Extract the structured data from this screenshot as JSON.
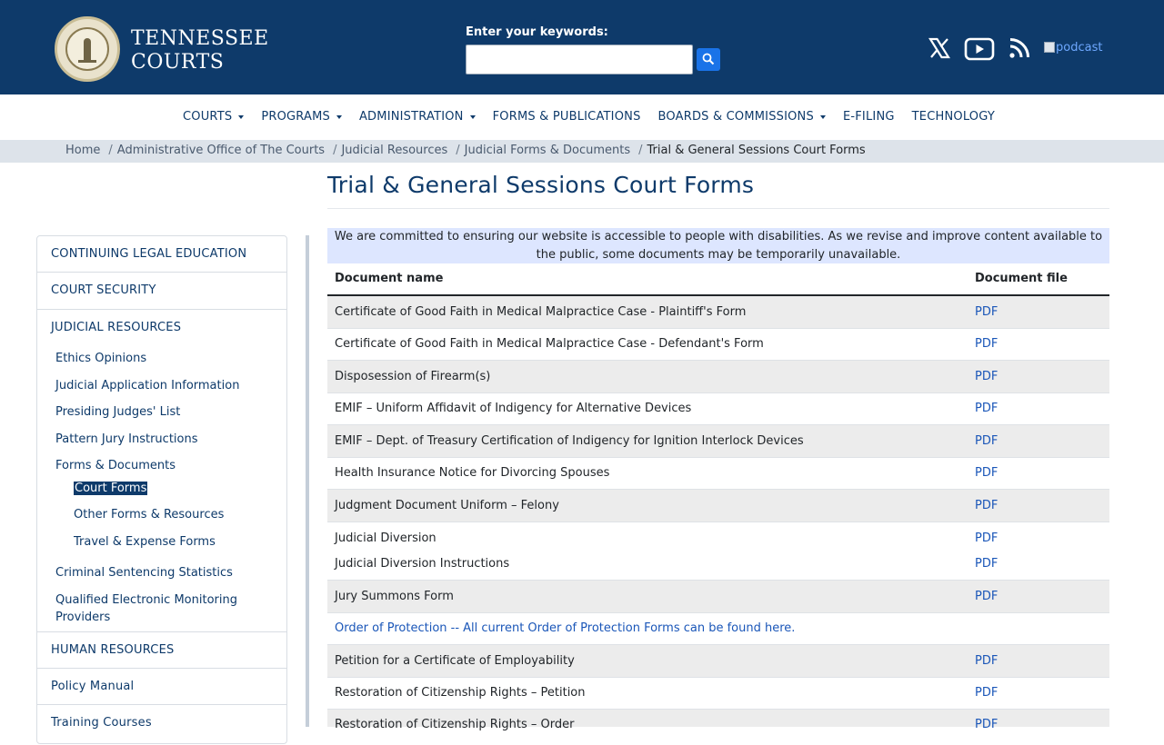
{
  "header": {
    "brand_line1": "TENNESSEE",
    "brand_line2": "COURTS",
    "search_label": "Enter your keywords:",
    "search_value": "",
    "podcast_alt": "podcast",
    "icons": [
      "x-twitter-icon",
      "youtube-icon",
      "rss-icon",
      "search-icon"
    ]
  },
  "nav": {
    "items": [
      {
        "label": "COURTS",
        "dropdown": true
      },
      {
        "label": "PROGRAMS",
        "dropdown": true
      },
      {
        "label": "ADMINISTRATION",
        "dropdown": true
      },
      {
        "label": "FORMS & PUBLICATIONS",
        "dropdown": false
      },
      {
        "label": "BOARDS & COMMISSIONS",
        "dropdown": true
      },
      {
        "label": "E-FILING",
        "dropdown": false
      },
      {
        "label": "TECHNOLOGY",
        "dropdown": false
      }
    ]
  },
  "breadcrumb": {
    "items": [
      "Home",
      "Administrative Office of The Courts",
      "Judicial Resources",
      "Judicial Forms & Documents"
    ],
    "current": "Trial & General Sessions Court Forms"
  },
  "page": {
    "title": "Trial & General Sessions Court Forms",
    "notice": "We are committed to ensuring our website is accessible to people with disabilities. As we revise and improve content available to the public, some documents may be temporarily unavailable."
  },
  "sidebar": {
    "top1": "CONTINUING LEGAL EDUCATION",
    "top2": "COURT SECURITY",
    "top3": "JUDICIAL RESOURCES",
    "sub": [
      "Ethics Opinions",
      "Judicial Application Information",
      "Presiding Judges' List",
      "Pattern Jury Instructions",
      "Forms & Documents"
    ],
    "subsub": [
      "Court Forms",
      "Other Forms & Resources",
      "Travel & Expense Forms"
    ],
    "sub2": [
      "Criminal Sentencing Statistics",
      "Qualified Electronic Monitoring",
      "Providers"
    ],
    "top4": "HUMAN RESOURCES",
    "top5": "Policy Manual",
    "top6": "Training Courses"
  },
  "table": {
    "col_name": "Document name",
    "col_file": "Document file",
    "rows": [
      {
        "name": "Certificate of Good Faith in Medical Malpractice Case - Plaintiff's Form",
        "file": "PDF"
      },
      {
        "name": "Certificate of Good Faith in Medical Malpractice Case - Defendant's Form",
        "file": "PDF"
      },
      {
        "name": "Disposession of Firearm(s)",
        "file": "PDF"
      },
      {
        "name": "EMIF – Uniform Affidavit of Indigency for Alternative Devices",
        "file": "PDF"
      },
      {
        "name": "EMIF – Dept. of Treasury Certification of Indigency for Ignition Interlock Devices",
        "file": "PDF"
      },
      {
        "name": "Health Insurance Notice for Divorcing Spouses",
        "file": "PDF"
      },
      {
        "name": "Judgment Document Uniform – Felony",
        "file": "PDF"
      },
      {
        "name": "Judicial Diversion",
        "file": "PDF"
      },
      {
        "name": "Judicial Diversion Instructions",
        "file": "PDF"
      },
      {
        "name": "Jury Summons Form",
        "file": "PDF"
      },
      {
        "name": "Order of Protection -- All current Order of Protection Forms can be found here.",
        "file": ""
      },
      {
        "name": "Petition for a Certificate of Employability",
        "file": "PDF"
      },
      {
        "name": "Restoration of Citizenship Rights – Petition",
        "file": "PDF"
      },
      {
        "name": "Restoration of Citizenship Rights – Order",
        "file": "PDF"
      }
    ]
  },
  "colors": {
    "header_bg": "#0e3a6a",
    "link": "#1a56b8",
    "notice_bg": "#dde6ff",
    "row_alt": "#ececec",
    "search_button": "#1a73e8"
  }
}
